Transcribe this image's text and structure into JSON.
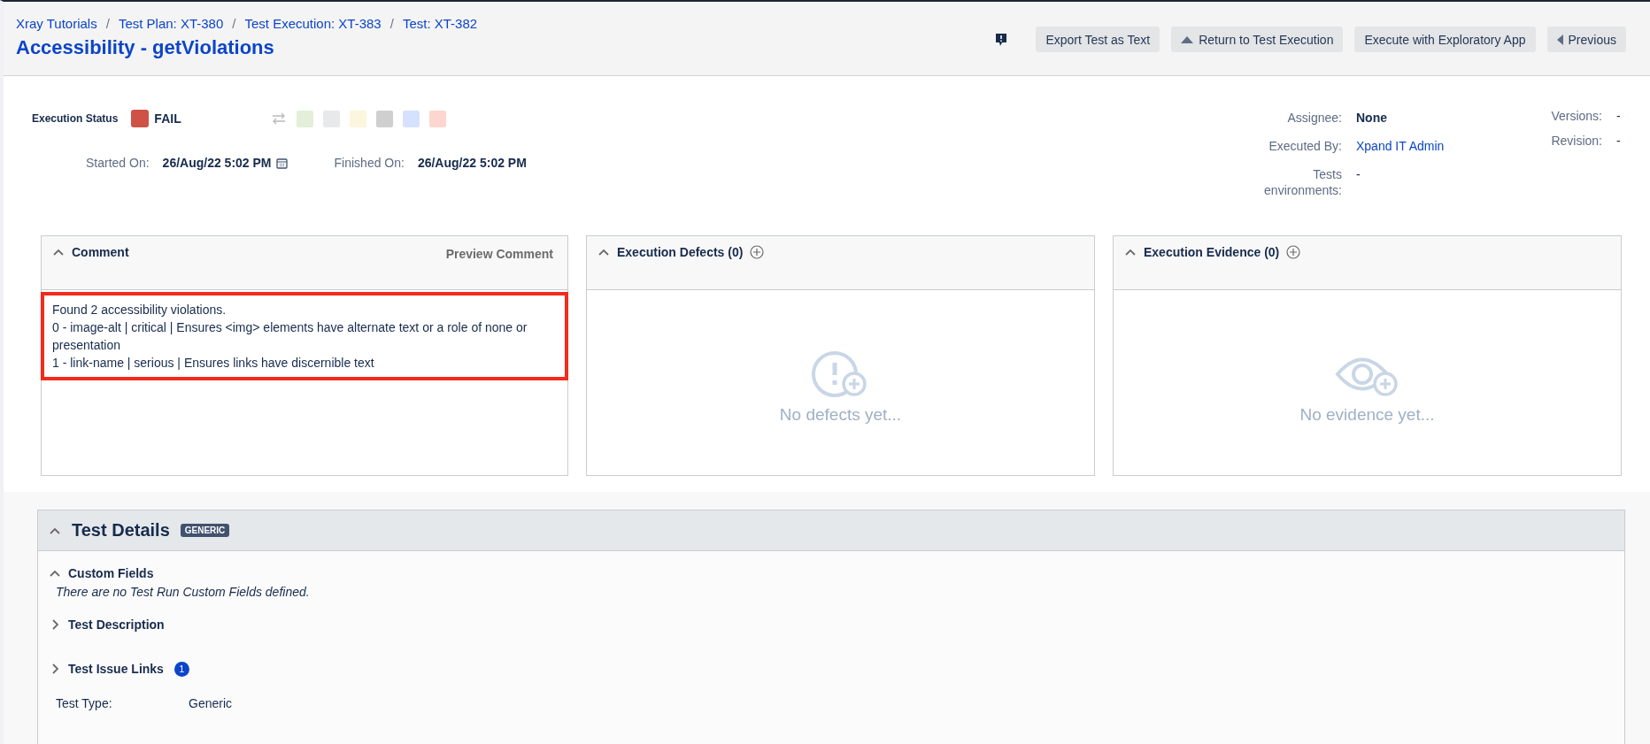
{
  "breadcrumbs": [
    {
      "label": "Xray Tutorials"
    },
    {
      "separator": "/",
      "label": "Test Plan: XT-380"
    },
    {
      "separator": "/",
      "label": "Test Execution: XT-383"
    },
    {
      "separator": "/",
      "label": "Test: XT-382"
    }
  ],
  "title": "Accessibility - getViolations",
  "toolbar": [
    {
      "label": "Export Test as Text",
      "kind": "plain"
    },
    {
      "label": "Return to Test Execution",
      "kind": "up"
    },
    {
      "label": "Execute with Exploratory App",
      "kind": "plain"
    },
    {
      "label": "Previous",
      "kind": "left"
    }
  ],
  "execution_status": {
    "label": "Execution Status",
    "value": "FAIL",
    "color": "#cf5246"
  },
  "status_options": [
    {
      "color": "#e3efd9"
    },
    {
      "color": "#e8e9eb"
    },
    {
      "color": "#fbf6dd"
    },
    {
      "color": "#cfcfcf"
    },
    {
      "color": "#d6e2fd"
    },
    {
      "color": "#fdd6cf"
    }
  ],
  "started": {
    "label": "Started On:",
    "value": "26/Aug/22 5:02 PM"
  },
  "finished": {
    "label": "Finished On:",
    "value": "26/Aug/22 5:02 PM"
  },
  "people": [
    {
      "label": "Assignee:",
      "value": "None",
      "kind": "bold"
    },
    {
      "label": "Executed By:",
      "value": "Xpand IT Admin",
      "kind": "link"
    },
    {
      "label": "Tests environments:",
      "value": "-",
      "kind": "plain"
    }
  ],
  "meta": [
    {
      "label": "Versions:",
      "value": "-"
    },
    {
      "label": "Revision:",
      "value": "-"
    }
  ],
  "comment": {
    "title": "Comment",
    "expanded": true,
    "action": "Preview Comment",
    "lines": [
      "Found 2 accessibility violations.",
      "0 - image-alt | critical | Ensures <img> elements have alternate text or a role of none or presentation",
      "1 - link-name | serious | Ensures links have discernible text"
    ]
  },
  "defects": {
    "title": "Execution Defects (0)",
    "expanded": true,
    "empty": "No defects yet..."
  },
  "evidence": {
    "title": "Execution Evidence (0)",
    "expanded": true,
    "empty": "No evidence yet..."
  },
  "test_details": {
    "title": "Test Details",
    "expanded": true,
    "badge": "GENERIC",
    "sections": [
      {
        "title": "Custom Fields",
        "expanded": true,
        "note": "There are no Test Run Custom Fields defined."
      },
      {
        "title": "Test Description",
        "expanded": false
      },
      {
        "title": "Test Issue Links",
        "expanded": false,
        "count": "1"
      }
    ],
    "fields": [
      {
        "label": "Test Type:",
        "value": "Generic"
      }
    ]
  }
}
